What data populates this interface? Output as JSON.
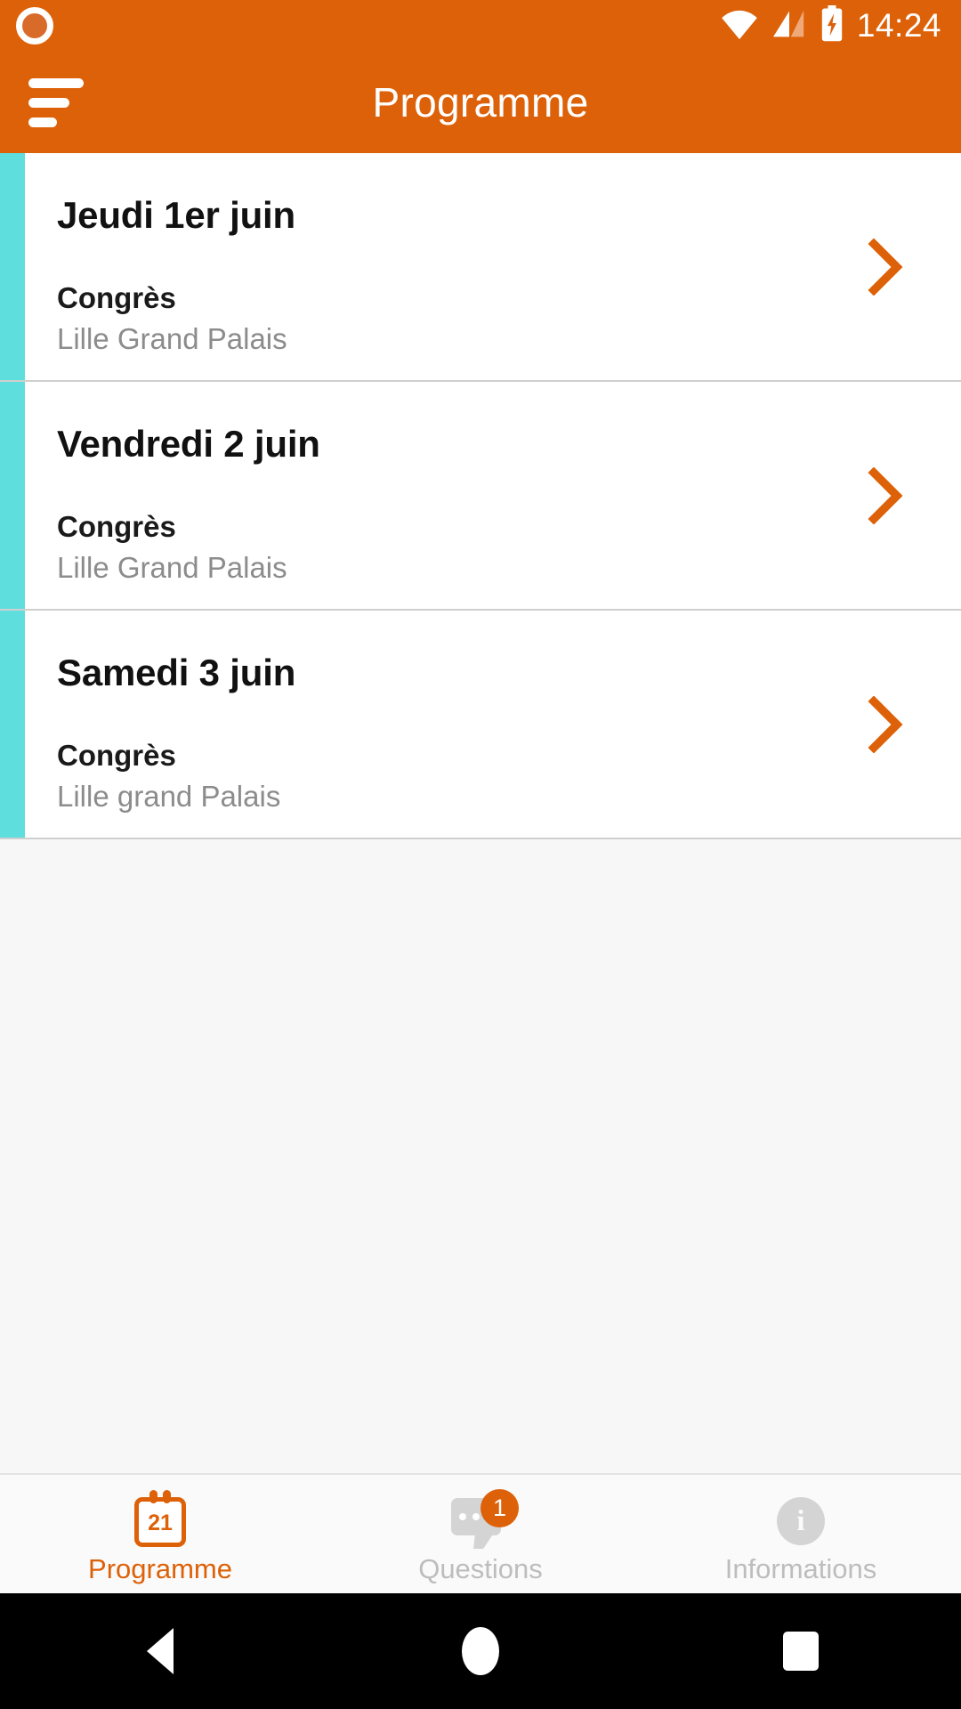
{
  "status_bar": {
    "recording_icon": "record-circle-icon",
    "wifi_icon": "wifi-icon",
    "signal_icon": "cellular-signal-icon",
    "battery_icon": "battery-charging-icon",
    "time": "14:24"
  },
  "app_bar": {
    "menu_icon": "hamburger-menu-icon",
    "title": "Programme"
  },
  "theme": {
    "primary": "#DD6108",
    "accent_stripe": "#5FDEDE",
    "text_primary": "#111111",
    "text_muted": "#8C8C8C",
    "tab_inactive": "#BDBDBD"
  },
  "list": {
    "items": [
      {
        "date": "Jeudi 1er juin",
        "category": "Congrès",
        "venue": "Lille Grand Palais",
        "chevron_icon": "chevron-right-icon"
      },
      {
        "date": "Vendredi 2 juin",
        "category": "Congrès",
        "venue": "Lille Grand Palais",
        "chevron_icon": "chevron-right-icon"
      },
      {
        "date": "Samedi 3 juin",
        "category": "Congrès",
        "venue": "Lille grand Palais",
        "chevron_icon": "chevron-right-icon"
      }
    ]
  },
  "tab_bar": {
    "tabs": [
      {
        "label": "Programme",
        "icon": "calendar-icon",
        "icon_day": "21",
        "active": true,
        "badge": ""
      },
      {
        "label": "Questions",
        "icon": "chat-bubble-icon",
        "active": false,
        "badge": "1"
      },
      {
        "label": "Informations",
        "icon": "info-circle-icon",
        "icon_glyph": "i",
        "active": false,
        "badge": ""
      }
    ]
  },
  "android_nav": {
    "back_icon": "back-triangle-icon",
    "home_icon": "home-circle-icon",
    "recents_icon": "recents-square-icon"
  }
}
